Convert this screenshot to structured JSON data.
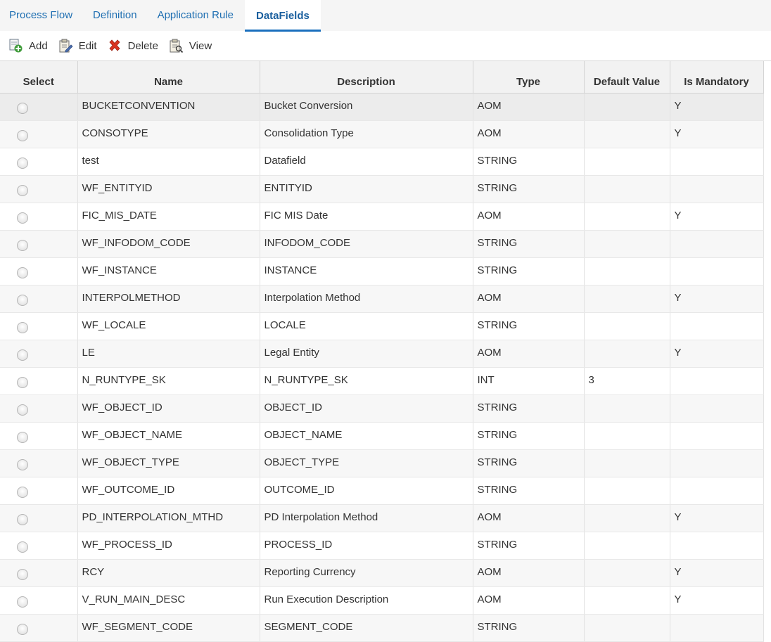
{
  "tabs": [
    {
      "label": "Process Flow",
      "active": false
    },
    {
      "label": "Definition",
      "active": false
    },
    {
      "label": "Application Rule",
      "active": false
    },
    {
      "label": "DataFields",
      "active": true
    }
  ],
  "toolbar": {
    "add_label": "Add",
    "edit_label": "Edit",
    "delete_label": "Delete",
    "view_label": "View"
  },
  "table": {
    "headers": {
      "select": "Select",
      "name": "Name",
      "description": "Description",
      "type": "Type",
      "default_value": "Default Value",
      "is_mandatory": "Is Mandatory"
    },
    "rows": [
      {
        "name": "BUCKETCONVENTION",
        "description": "Bucket Conversion",
        "type": "AOM",
        "default_value": "",
        "is_mandatory": "Y"
      },
      {
        "name": "CONSOTYPE",
        "description": "Consolidation Type",
        "type": "AOM",
        "default_value": "",
        "is_mandatory": "Y"
      },
      {
        "name": "test",
        "description": "Datafield",
        "type": "STRING",
        "default_value": "",
        "is_mandatory": ""
      },
      {
        "name": "WF_ENTITYID",
        "description": "ENTITYID",
        "type": "STRING",
        "default_value": "",
        "is_mandatory": ""
      },
      {
        "name": "FIC_MIS_DATE",
        "description": "FIC MIS Date",
        "type": "AOM",
        "default_value": "",
        "is_mandatory": "Y"
      },
      {
        "name": "WF_INFODOM_CODE",
        "description": "INFODOM_CODE",
        "type": "STRING",
        "default_value": "",
        "is_mandatory": ""
      },
      {
        "name": "WF_INSTANCE",
        "description": "INSTANCE",
        "type": "STRING",
        "default_value": "",
        "is_mandatory": ""
      },
      {
        "name": "INTERPOLMETHOD",
        "description": "Interpolation Method",
        "type": "AOM",
        "default_value": "",
        "is_mandatory": "Y"
      },
      {
        "name": "WF_LOCALE",
        "description": "LOCALE",
        "type": "STRING",
        "default_value": "",
        "is_mandatory": ""
      },
      {
        "name": "LE",
        "description": "Legal Entity",
        "type": "AOM",
        "default_value": "",
        "is_mandatory": "Y"
      },
      {
        "name": "N_RUNTYPE_SK",
        "description": "N_RUNTYPE_SK",
        "type": "INT",
        "default_value": "3",
        "is_mandatory": ""
      },
      {
        "name": "WF_OBJECT_ID",
        "description": "OBJECT_ID",
        "type": "STRING",
        "default_value": "",
        "is_mandatory": ""
      },
      {
        "name": "WF_OBJECT_NAME",
        "description": "OBJECT_NAME",
        "type": "STRING",
        "default_value": "",
        "is_mandatory": ""
      },
      {
        "name": "WF_OBJECT_TYPE",
        "description": "OBJECT_TYPE",
        "type": "STRING",
        "default_value": "",
        "is_mandatory": ""
      },
      {
        "name": "WF_OUTCOME_ID",
        "description": "OUTCOME_ID",
        "type": "STRING",
        "default_value": "",
        "is_mandatory": ""
      },
      {
        "name": "PD_INTERPOLATION_MTHD",
        "description": "PD Interpolation Method",
        "type": "AOM",
        "default_value": "",
        "is_mandatory": "Y"
      },
      {
        "name": "WF_PROCESS_ID",
        "description": "PROCESS_ID",
        "type": "STRING",
        "default_value": "",
        "is_mandatory": ""
      },
      {
        "name": "RCY",
        "description": "Reporting Currency",
        "type": "AOM",
        "default_value": "",
        "is_mandatory": "Y"
      },
      {
        "name": "V_RUN_MAIN_DESC",
        "description": "Run Execution Description",
        "type": "AOM",
        "default_value": "",
        "is_mandatory": "Y"
      },
      {
        "name": "WF_SEGMENT_CODE",
        "description": "SEGMENT_CODE",
        "type": "STRING",
        "default_value": "",
        "is_mandatory": ""
      }
    ]
  },
  "icons": {
    "add": "add-document-icon",
    "edit": "edit-clipboard-icon",
    "delete": "red-x-icon",
    "view": "view-clipboard-icon"
  },
  "colors": {
    "tab_text": "#1f6fb2",
    "active_tab_underline": "#1a6fbd",
    "delete_icon": "#d9331f"
  }
}
